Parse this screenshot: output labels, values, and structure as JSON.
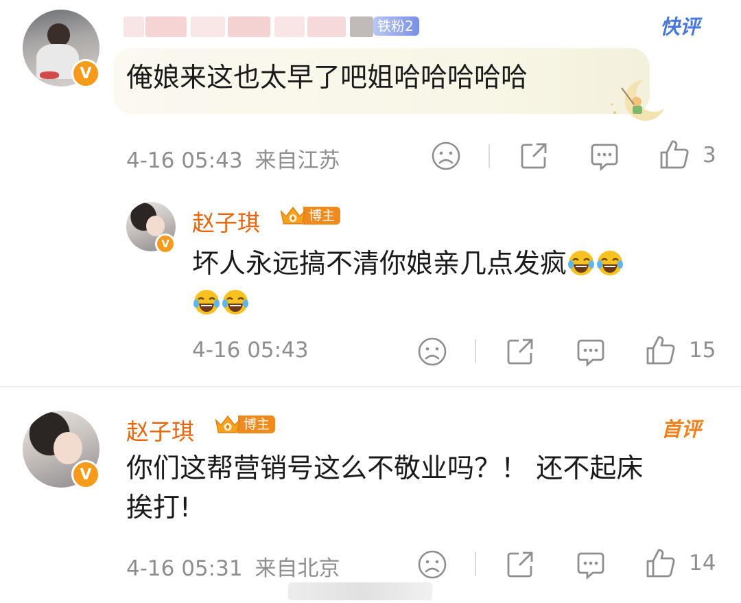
{
  "comments": [
    {
      "text": "俺娘来这也太早了吧姐哈哈哈哈哈",
      "fan_badge": "铁粉2",
      "corner_tag": "快评",
      "time": "4-16 05:43",
      "location": "来自江苏",
      "likes": "3"
    },
    {
      "author": "赵子琪",
      "role_badge": "博主",
      "text": "坏人永远搞不清你娘亲几点发疯",
      "time": "4-16 05:43",
      "likes": "15"
    },
    {
      "author": "赵子琪",
      "role_badge": "博主",
      "corner_tag": "首评",
      "text_line1": "你们这帮营销号这么不敬业吗？！ 还不起床",
      "text_line2": "挨打!",
      "time": "4-16 05:31",
      "location": "来自北京",
      "likes": "14"
    }
  ],
  "colors": {
    "name": "#e8650f",
    "meta": "#8e8e8e",
    "verified_badge": "#f59a1b",
    "kuaiping": "#4a78d8",
    "shouping": "#f0801a"
  },
  "icons": [
    "sad-face-icon",
    "share-icon",
    "comment-icon",
    "like-icon",
    "laugh-cry-emoji-icon",
    "verified-v-icon",
    "crown-icon"
  ]
}
